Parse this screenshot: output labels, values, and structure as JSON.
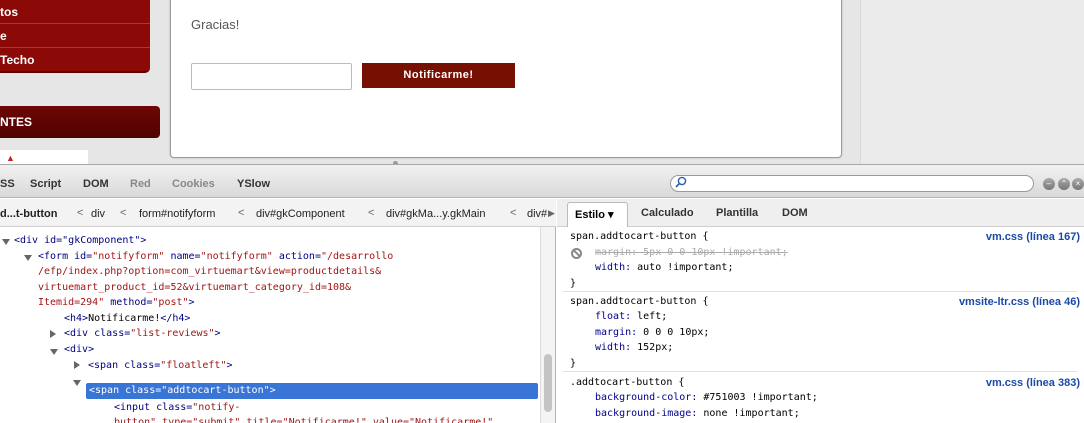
{
  "webpage": {
    "menu_items": [
      "tos",
      "e",
      "Techo"
    ],
    "section_title": "NTES",
    "thanks_text": "Gracias!",
    "notify_email_placeholder": "",
    "notify_button_label": "Notificarme!"
  },
  "devtools": {
    "top_tabs": [
      "SS",
      "Script",
      "DOM",
      "Red",
      "Cookies",
      "YSlow"
    ],
    "search_placeholder": "",
    "breadcrumbs": [
      "d...t-button",
      "div",
      "form#notifyform",
      "div#gkComponent",
      "div#gkMa...y.gkMain",
      "div#"
    ],
    "side_tabs": [
      "Estilo ▾",
      "Calculado",
      "Plantilla",
      "DOM"
    ],
    "dom_tree": {
      "line0": "<div id=\"gkComponent\">",
      "line0_partial_prev": "div id=\"gkComponent\">",
      "form_open_a": "<form ",
      "form_attr1_name": "id=",
      "form_attr1_val": "\"notifyform\"",
      "form_attr2_name": " name=",
      "form_attr2_val": "\"notifyform\"",
      "form_attr3_name": " action=",
      "form_attr3_val": "\"/desarrollo",
      "form_line2": "/efp/index.php?option=com_virtuemart&view=productdetails&",
      "form_line3": "virtuemart_product_id=52&virtuemart_category_id=108&",
      "form_line4_val": "Itemid=294\"",
      "form_line4_rest_name": " method=",
      "form_line4_rest_val": "\"post\"",
      "form_line4_close": ">",
      "h4_open": "<h4>",
      "h4_text": "Notificarme!",
      "h4_close": "</h4>",
      "div_list_open": "<div ",
      "div_list_attr": "class=",
      "div_list_val": "\"list-reviews\"",
      "div_list_close": ">",
      "div_plain": "<div>",
      "span_float_open": "<span ",
      "span_float_attr": "class=",
      "span_float_val": "\"floatleft\"",
      "span_float_close": ">",
      "span_sel": "<span class=\"addtocart-button\">",
      "input_line1_open": "<input ",
      "input_line1_attr": "class=",
      "input_line1_val": "\"notify-",
      "input_line2": "button\" type=\"submit\" title=\"Notificarme!\" value=\"Notificarme!\""
    },
    "css_rules": {
      "rule1_selector": "span.addtocart-button {",
      "rule1_src": "vm.css (línea 167)",
      "rule1_prop1": "margin: 5px 0 0 10px !important;",
      "rule1_prop2_name": "width:",
      "rule1_prop2_val": " auto !important;",
      "rule1_close": "}",
      "rule2_selector": "span.addtocart-button {",
      "rule2_src": "vmsite-ltr.css (línea 46)",
      "rule2_prop1_name": "float:",
      "rule2_prop1_val": " left;",
      "rule2_prop2_name": "margin:",
      "rule2_prop2_val": " 0 0 0 10px;",
      "rule2_prop3_name": "width:",
      "rule2_prop3_val": " 152px;",
      "rule2_close": "}",
      "rule3_selector": ".addtocart-button {",
      "rule3_src": "vm.css (línea 383)",
      "rule3_prop1_name": "background-color:",
      "rule3_prop1_val": " #751003 !important;",
      "rule3_prop2_name": "background-image:",
      "rule3_prop2_val": " none !important;"
    }
  },
  "colors": {
    "brand_red": "#751003",
    "selection_blue": "#3875d7",
    "source_link": "#1a4aa8"
  }
}
